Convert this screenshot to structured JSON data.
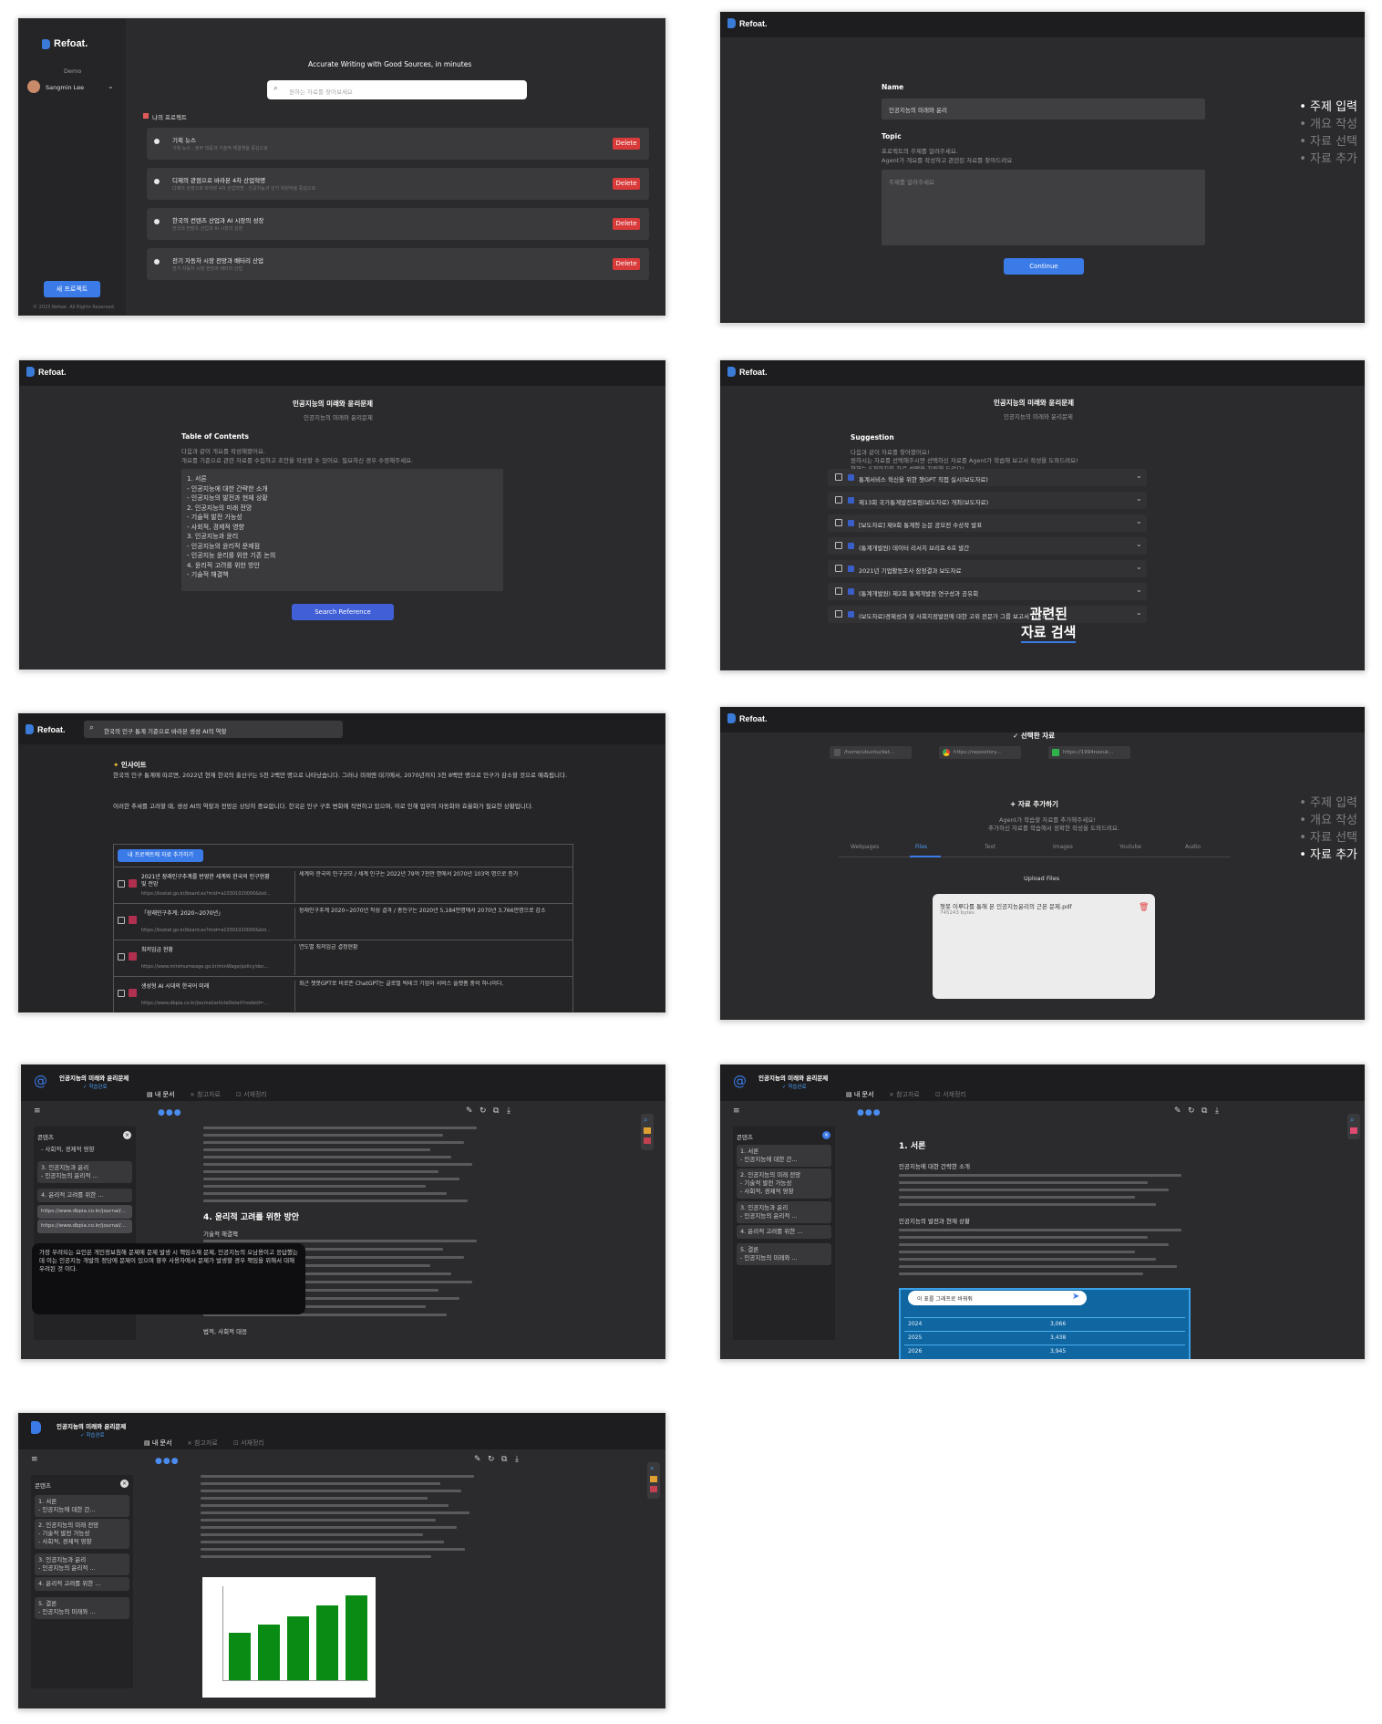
{
  "brand": "Refoat.",
  "p1": {
    "workspace": "Demo",
    "user": "Sangmin Lee",
    "headline": "Accurate Writing with Good Sources, in minutes",
    "search_placeholder": "원하는 자료를 찾아보세요",
    "projects_label": "나의 프로젝트",
    "projects": [
      {
        "title": "기획 뉴스",
        "sub": "기획 뉴스 : 정부 대응과 기술적 해결책을 중심으로"
      },
      {
        "title": "디제의 관점으로 바라본 4차 산업혁명",
        "sub": "디제의 관점으로 바라본 4차 산업혁명 : 인공지능과 인기 위원작을 중심으로"
      },
      {
        "title": "한국의 컨텐츠 산업과 AI 시장의 성장",
        "sub": "한국의 컨텐츠 산업과 AI 시장의 성장"
      },
      {
        "title": "전기 자동차 시장 전망과 배터리 산업",
        "sub": "전기 자동차 시장 전망과 배터리 산업"
      }
    ],
    "delete": "Delete",
    "new_project": "새 프로젝트",
    "footer": "© 2023 Refoat. All Rights Reserved."
  },
  "p2": {
    "name_label": "Name",
    "name_value": "인공지능의 미래와 윤리",
    "topic_label": "Topic",
    "topic_help1": "프로젝트의 주제를 알려주세요.",
    "topic_help2": "Agent가 개요를 작성하고 관련된 자료를 찾아드려요",
    "topic_placeholder": "주제를 알려주세요",
    "continue": "Continue",
    "steps": [
      "주제 입력",
      "개요 작성",
      "자료 선택",
      "자료 추가"
    ]
  },
  "p3": {
    "title": "인공지능의 미래와 윤리문제",
    "subtitle": "인공지능의 미래와 윤리문제",
    "toc_label": "Table of Contents",
    "toc_help1": "다음과 같이 개요를 작성해봤어요.",
    "toc_help2": "개요를 기준으로 관련 자료를 수집하고 초안을 작성할 수 있어요. 필요하신 경우 수정해주세요.",
    "toc_lines": [
      "1. 서론",
      "- 인공지능에 대한 간략한 소개",
      "- 인공지능의 발전과 현재 상황",
      "2. 인공지능의 미래 전망",
      "- 기술적 발전 가능성",
      "- 사회적, 경제적 영향",
      "3. 인공지능과 윤리",
      "- 인공지능의 윤리적 문제점",
      "- 인공지능 윤리를 위한 기존 논의",
      "4. 윤리적 고려를 위한 방안",
      "- 기술적 해결책"
    ],
    "search_ref": "Search Reference"
  },
  "p4": {
    "title": "인공지능의 미래와 윤리문제",
    "subtitle": "인공지능의 미래와 윤리문제",
    "suggest_label": "Suggestion",
    "suggest_help1": "다음과 같이 자료를 찾아봤어요!",
    "suggest_help2": "원하시는 자료를 선택해주시면 선택하신 자료를 Agent가 학습해 보고서 작성을 도와드려요!",
    "suggest_help3": "현재는 5개까지의 자료 선택을 지원해 드려요!",
    "items": [
      "통계서비스 혁신을 위한 챗GPT 직접 실시(보도자료)",
      "제13회 국가통계발전포럼(보도자료) 개최(보도자료)",
      "[보도자료] 제9회 통계청 논문 공모전 수상작 발표",
      "(통계개발원) 데이터 리서치 브리프 6호 발간",
      "2021년 기업활동조사 잠정결과 보도자료",
      "(통계개발원) 제2회 통계개발원 연구성과 공유회",
      "(보도자료)경제성과 및 사회지정발전에 대한 고위 전문가 그룹 보고서 _127"
    ],
    "overlay1": "관련된",
    "overlay2": "자료 검색"
  },
  "p5": {
    "search_value": "한국의 인구 통계 기준으로 바라본 생성 AI의 역할",
    "insight_label": "인사이트",
    "insight_text1": "한국의 인구 통계에 따르면, 2022년 현재 한국의 출산구는 5천 2백만 명으로 나타났습니다. 그러나 미래엔 대기에서, 2070년까지 3천 8백만 명으로 인구가 감소할 것으로 예측됩니다.",
    "insight_text2": "이러한 추세를 고려할 때, 생성 AI의 역할과 전망은 상당히 중요합니다. 한국은 인구 구조 변화에 직면하고 있으며, 이로 인해 업무의 자동화와 효율화가 필요한 상황입니다.",
    "add_btn": "내 프로젝트에 자료 추가하기",
    "rows": [
      {
        "title": "2021년 장래인구추계를 반영한 세계와 한국의 인구현황 및 전망",
        "url": "https://kostat.go.kr/board.es?mid=a10301020000&bid...",
        "summary": "세계와 한국의 인구규모 / 세계 인구는 2022년 79억 7천만 명에서 2070년 103억 명으로 증가"
      },
      {
        "title": "「장래인구추계: 2020~2070년」",
        "url": "https://kostat.go.kr/board.es?mid=a10301020000&bid...",
        "summary": "장래인구추계 2020~2070년 작성 결과 / 총인구는 2020년 5,184만명에서 2070년 3,766만명으로 감소"
      },
      {
        "title": "최저임금 현황",
        "url": "https://www.minimumwage.go.kr/minWage/policy/dec...",
        "summary": "연도별 최저임금 결정현황"
      },
      {
        "title": "생성형 AI 시대의 한국어 미래",
        "url": "https://www.dbpia.co.kr/journal/articleDetail?nodeId=...",
        "summary": "최근 챗봇GPT로 비로존 ChatGPT는 글로벌 빅테크 기업이 서비스 플랫폼 중의 하나이다."
      }
    ]
  },
  "p6": {
    "selected_label": "✓ 선택한 자료",
    "chips": [
      "/home/ubuntu/dat...",
      "https://repository...",
      "https://1994nezuk..."
    ],
    "add_label": "+ 자료 추가하기",
    "add_help1": "Agent가 학습할 자료를 추가해주세요!",
    "add_help2": "추가하신 자료를 학습해서 정확한 작성을 도와드려요.",
    "tabs": [
      "Webpages",
      "Files",
      "Text",
      "Images",
      "Youtube",
      "Audio"
    ],
    "upload_label": "Upload Files",
    "file_name": "챗봇 이루다를 통해 본 인공지능윤리의 근본 문제.pdf",
    "file_size": "745243 bytes",
    "steps": [
      "주제 입력",
      "개요 작성",
      "자료 선택",
      "자료 추가"
    ]
  },
  "p7": {
    "title": "인공지능의 미래와 윤리문제",
    "tag": "✓ 학습완료",
    "tabs": [
      "내 문서",
      "참고자료",
      "서재정리"
    ],
    "toc_label": "콘텐츠",
    "toc_items": [
      "- 사회적, 경제적 영향",
      "3. 인공지능과 윤리\n- 인공지능의 윤리적 ...",
      "4. 윤리적 고려를 위한 ...",
      "https://www.dbpia.co.kr/journal/...",
      "https://www.dbpia.co.kr/journal/..."
    ],
    "heading": "4. 윤리적 고려를 위한 방안",
    "subheading": "기술적 해결책",
    "subheading2": "법적, 사회적 대응",
    "popup_text": "가장 우려되는 요인은 개인정보침해 문제에 문제 발생 시 책임소재 문제, 인공지능의 오남용이고 응답했는데 이는 인공지능 개발의 정당에 문제이 있으며 향후 사용자에서 문제가 발생할 경우 책임을 위해서 대해 우려된 것 이다."
  },
  "p8": {
    "title": "인공지능의 미래와 윤리문제",
    "tag": "✓ 학습완료",
    "tabs": [
      "내 문서",
      "참고자료",
      "서재정리"
    ],
    "toc_label": "콘텐츠",
    "toc_items": [
      "1. 서론\n- 인공지능에 대한 간...",
      "2. 인공지능의 미래 전망\n- 기술적 발전 가능성\n- 사회적, 경제적 영향",
      "3. 인공지능과 윤리\n- 인공지능의 윤리적 ...",
      "4. 윤리적 고려를 위한 ...",
      "5. 결론\n- 인공지능의 미래와 ..."
    ],
    "heading": "1. 서론",
    "sub1": "인공지능에 대한 간략한 소개",
    "sub2": "인공지능의 발전과 현재 상황",
    "chat_input": "이 표를 그래프로 바꿔줘",
    "table_rows": [
      [
        "2024",
        "3,066"
      ],
      [
        "2025",
        "3,438"
      ],
      [
        "2026",
        "3,945"
      ]
    ]
  },
  "p9": {
    "title": "인공지능의 미래와 윤리문제",
    "tag": "✓ 학습완료",
    "tabs": [
      "내 문서",
      "참고자료",
      "서재정리"
    ],
    "toc_label": "콘텐츠",
    "toc_items": [
      "1. 서론\n- 인공지능에 대한 간...",
      "2. 인공지능의 미래 전망\n- 기술적 발전 가능성\n- 사회적, 경제적 영향",
      "3. 인공지능과 윤리\n- 인공지능의 윤리적 ...",
      "4. 윤리적 고려를 위한 ...",
      "5. 결론\n- 인공지능의 미래와 ..."
    ],
    "chart_bars": [
      0.52,
      0.61,
      0.7,
      0.82,
      0.93
    ]
  }
}
